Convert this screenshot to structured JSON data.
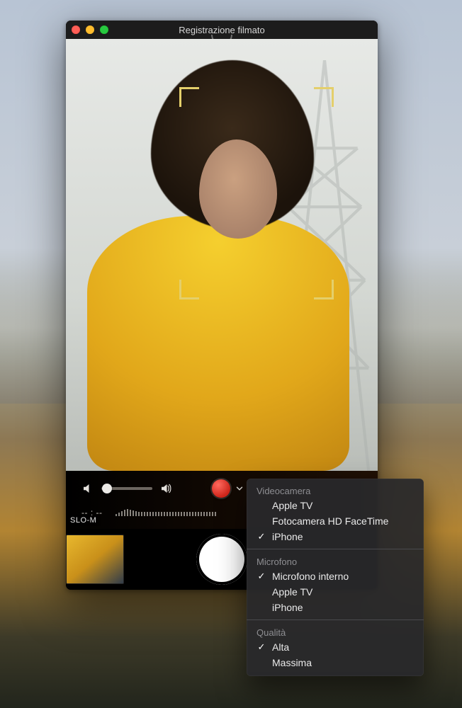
{
  "window": {
    "title": "Registrazione filmato"
  },
  "controls": {
    "timecode": "-- : --",
    "slomo_badge": "SLO-M"
  },
  "menu": {
    "camera": {
      "heading": "Videocamera",
      "items": [
        {
          "label": "Apple TV",
          "checked": false
        },
        {
          "label": "Fotocamera HD FaceTime",
          "checked": false
        },
        {
          "label": "iPhone",
          "checked": true
        }
      ]
    },
    "microphone": {
      "heading": "Microfono",
      "items": [
        {
          "label": "Microfono interno",
          "checked": true
        },
        {
          "label": "Apple TV",
          "checked": false
        },
        {
          "label": "iPhone",
          "checked": false
        }
      ]
    },
    "quality": {
      "heading": "Qualità",
      "items": [
        {
          "label": "Alta",
          "checked": true
        },
        {
          "label": "Massima",
          "checked": false
        }
      ]
    }
  }
}
